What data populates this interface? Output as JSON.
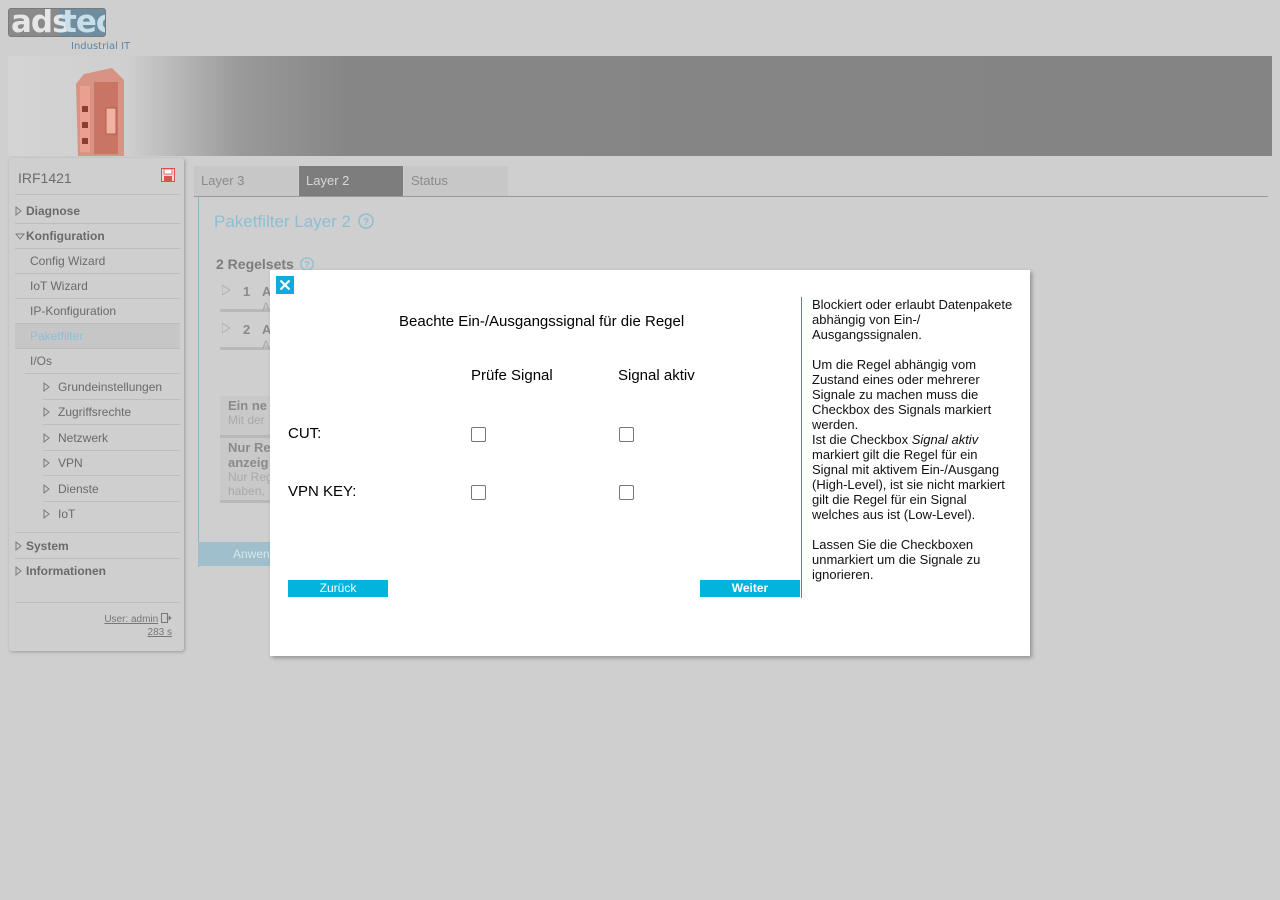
{
  "header": {
    "logo_ads": "ads",
    "logo_tec": "tec",
    "logo_subtitle": "Industrial IT"
  },
  "sidebar": {
    "device_name": "IRF1421",
    "items": [
      {
        "label": "Diagnose"
      },
      {
        "label": "Konfiguration"
      },
      {
        "label": "Config Wizard"
      },
      {
        "label": "IoT Wizard"
      },
      {
        "label": "IP-Konfiguration"
      },
      {
        "label": "Paketfilter"
      },
      {
        "label": "I/Os"
      },
      {
        "label": "Grundeinstellungen"
      },
      {
        "label": "Zugriffsrechte"
      },
      {
        "label": "Netzwerk"
      },
      {
        "label": "VPN"
      },
      {
        "label": "Dienste"
      },
      {
        "label": "IoT"
      },
      {
        "label": "System"
      },
      {
        "label": "Informationen"
      }
    ],
    "user_label": "User: admin",
    "session_time": "283 s"
  },
  "tabs": [
    {
      "label": "Layer 3"
    },
    {
      "label": "Layer 2"
    },
    {
      "label": "Status"
    }
  ],
  "main": {
    "page_title": "Paketfilter Layer 2",
    "rulesets_title": "2 Regelsets",
    "rules": [
      {
        "num": "1",
        "name": "A",
        "sub": "A"
      },
      {
        "num": "2",
        "name": "A",
        "sub": "A"
      }
    ],
    "info1_title": "Ein ne",
    "info1_text": "Mit der",
    "info2_title_1": "Nur Re",
    "info2_title_2": "anzeig",
    "info2_text_1": "Nur Reg",
    "info2_text_2": "haben,",
    "apply_label": "Anwen"
  },
  "modal": {
    "title": "Beachte Ein-/Ausgangssignal für die Regel",
    "col_check": "Prüfe Signal",
    "col_active": "Signal aktiv",
    "rows": [
      {
        "label": "CUT:",
        "check": false,
        "active": false
      },
      {
        "label": "VPN KEY:",
        "check": false,
        "active": false
      }
    ],
    "back_label": "Zurück",
    "next_label": "Weiter",
    "help": {
      "p1": "Blockiert oder erlaubt Datenpakete abhängig von Ein-/ Ausgangssignalen.",
      "p2a": "Um die Regel abhängig vom Zustand eines oder mehrerer Signale zu machen muss die Checkbox des Signals markiert werden.",
      "p2b": "Ist die Checkbox ",
      "p2b_em": "Signal aktiv",
      "p2c": " markiert gilt die Regel für ein Signal mit aktivem Ein-/Ausgang (High-Level), ist sie nicht markiert gilt die Regel für ein Signal welches aus ist (Low-Level).",
      "p3": "Lassen Sie die Checkboxen unmarkiert um die Signale zu ignorieren."
    }
  },
  "colors": {
    "accent": "#00b4dc",
    "close_button": "#10acd8",
    "active_nav": "#8cc0d6"
  }
}
